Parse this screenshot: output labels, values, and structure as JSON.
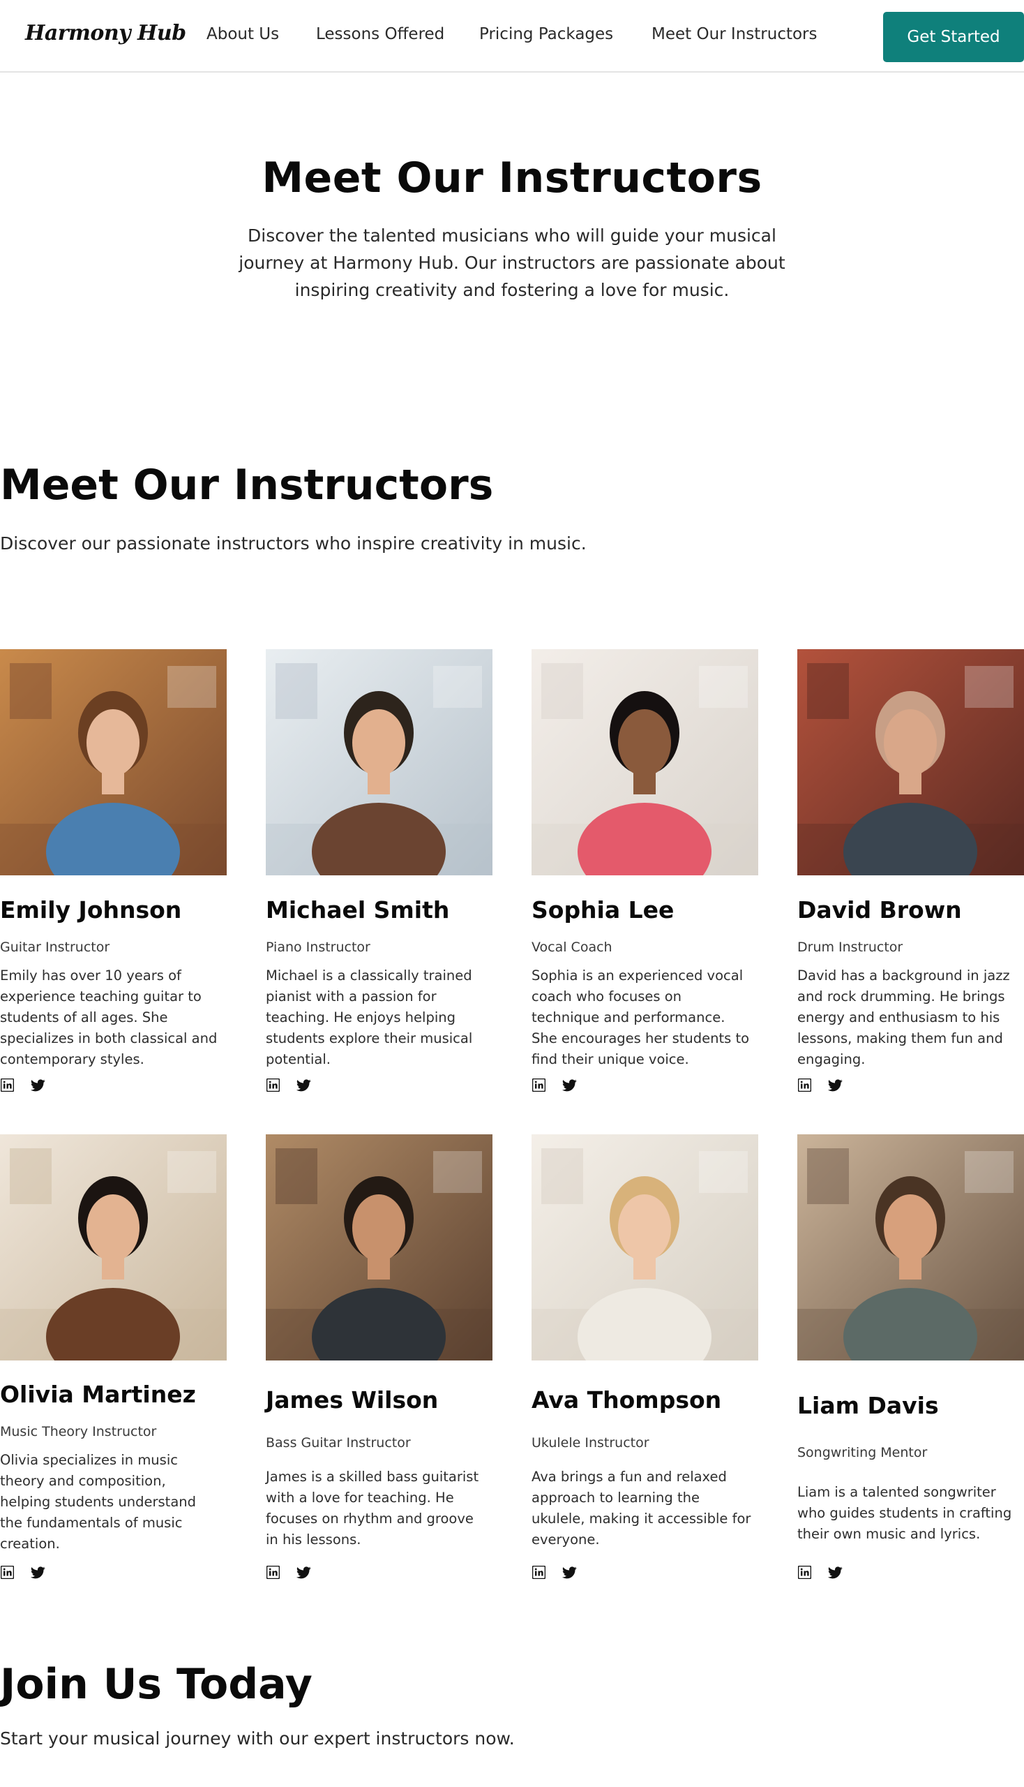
{
  "nav": {
    "logo": "Harmony Hub",
    "links": [
      "About Us",
      "Lessons Offered",
      "Pricing Packages",
      "Meet Our Instructors"
    ],
    "cta": "Get Started"
  },
  "hero": {
    "title": "Meet Our Instructors",
    "subtitle_lines": [
      "Discover the talented musicians who will guide your musical",
      "journey at Harmony Hub. Our instructors are passionate about",
      "inspiring creativity and fostering a love for music."
    ]
  },
  "section": {
    "title": "Meet Our Instructors",
    "subtitle": "Discover our passionate instructors who inspire creativity in music."
  },
  "instructors": [
    {
      "name": "Emily Johnson",
      "role": "Guitar Instructor",
      "bio_lines": [
        "Emily has over 10 years of",
        "experience teaching guitar to",
        "students of all ages. She",
        "specializes in both classical and",
        "contemporary styles."
      ]
    },
    {
      "name": "Michael Smith",
      "role": "Piano Instructor",
      "bio_lines": [
        "Michael is a classically trained",
        "pianist with a passion for",
        "teaching. He enjoys helping",
        "students explore their musical",
        "potential."
      ]
    },
    {
      "name": "Sophia Lee",
      "role": "Vocal Coach",
      "bio_lines": [
        "Sophia is an experienced vocal",
        "coach who focuses on",
        "technique and performance.",
        "She encourages her students to",
        "find their unique voice."
      ]
    },
    {
      "name": "David Brown",
      "role": "Drum Instructor",
      "bio_lines": [
        "David has a background in jazz",
        "and rock drumming. He brings",
        "energy and enthusiasm to his",
        "lessons, making them fun and",
        "engaging."
      ]
    },
    {
      "name": "Olivia Martinez",
      "role": "Music Theory Instructor",
      "bio_lines": [
        "Olivia specializes in music",
        "theory and composition,",
        "helping students understand",
        "the fundamentals of music",
        "creation."
      ]
    },
    {
      "name": "James Wilson",
      "role": "Bass Guitar Instructor",
      "bio_lines": [
        "James is a skilled bass guitarist",
        "with a love for teaching. He",
        "focuses on rhythm and groove",
        "in his lessons."
      ]
    },
    {
      "name": "Ava Thompson",
      "role": "Ukulele Instructor",
      "bio_lines": [
        "Ava brings a fun and relaxed",
        "approach to learning the",
        "ukulele, making it accessible for",
        "everyone."
      ]
    },
    {
      "name": "Liam Davis",
      "role": "Songwriting Mentor",
      "bio_lines": [
        "Liam is a talented songwriter",
        "who guides students in crafting",
        "their own music and lyrics."
      ]
    }
  ],
  "icons": {
    "social_primary": "linkedin-icon",
    "social_secondary": "twitter-icon"
  },
  "colors": {
    "accent": "#0f807b",
    "text": "#0a0a0a"
  },
  "join": {
    "title": "Join Us Today",
    "subtitle": "Start your musical journey with our expert instructors now."
  }
}
